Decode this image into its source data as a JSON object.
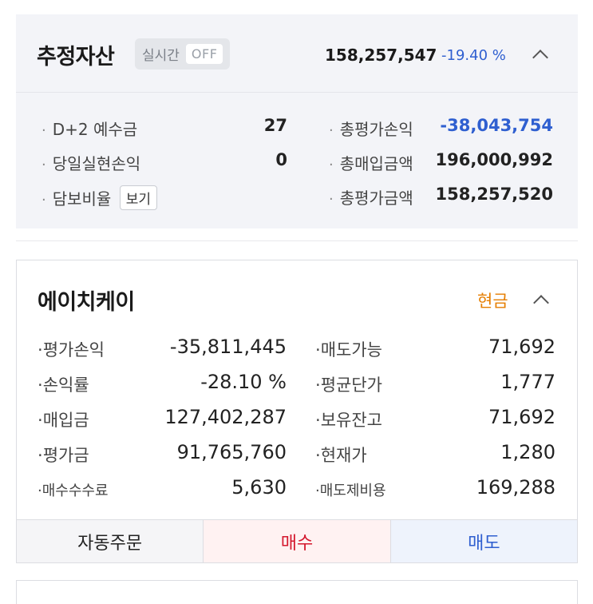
{
  "summary": {
    "title": "추정자산",
    "realtime_label": "실시간",
    "realtime_state": "OFF",
    "total": "158,257,547",
    "rate": "-19.40 %",
    "rows": [
      {
        "label": "D+2 예수금",
        "value": "27"
      },
      {
        "label": "당일실현손익",
        "value": "0"
      },
      {
        "label": "담보비율",
        "button": "보기"
      }
    ],
    "right_rows": [
      {
        "label": "총평가손익",
        "value": "-38,043,754"
      },
      {
        "label": "총매입금액",
        "value": "196,000,992"
      },
      {
        "label": "총평가금액",
        "value": "158,257,520"
      }
    ]
  },
  "stock": {
    "name": "에이치케이",
    "account_type": "현금",
    "left_rows": [
      {
        "label": "평가손익",
        "value": "-35,811,445"
      },
      {
        "label": "손익률",
        "value": "-28.10 %"
      },
      {
        "label": "매입금",
        "value": "127,402,287"
      },
      {
        "label": "평가금",
        "value": "91,765,760"
      },
      {
        "label": "매수수수료",
        "value": "5,630"
      }
    ],
    "right_rows": [
      {
        "label": "매도가능",
        "value": "71,692"
      },
      {
        "label": "평균단가",
        "value": "1,777"
      },
      {
        "label": "보유잔고",
        "value": "71,692"
      },
      {
        "label": "현재가",
        "value": "1,280"
      },
      {
        "label": "매도제비용",
        "value": "169,288"
      }
    ],
    "actions": {
      "auto": "자동주문",
      "buy": "매수",
      "sell": "매도"
    }
  },
  "colors": {
    "negative": "#2f5fd0",
    "current_price": "#d4182e",
    "cash": "#e67e00"
  }
}
